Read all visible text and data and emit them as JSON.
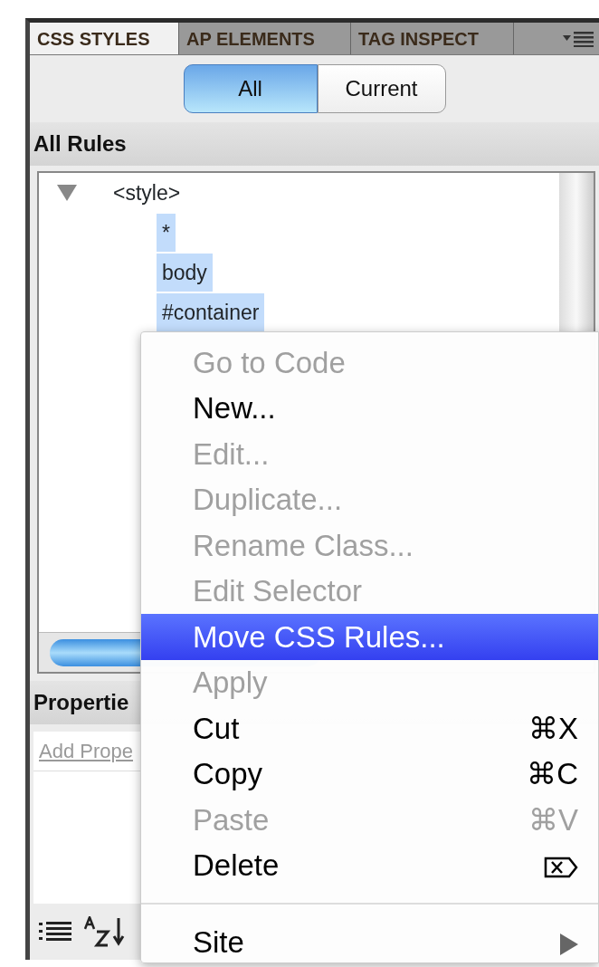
{
  "panel_tabs": [
    {
      "label": "CSS STYLES",
      "selected": true
    },
    {
      "label": "AP ELEMENTS",
      "selected": false
    },
    {
      "label": "TAG INSPECT",
      "selected": false
    }
  ],
  "view_toggle": [
    {
      "label": "All",
      "selected": true
    },
    {
      "label": "Current",
      "selected": false
    }
  ],
  "rules_header": "All Rules",
  "rules_tree": [
    {
      "label": "<style>",
      "expanded": true,
      "selected": false,
      "children": [
        {
          "label": "*",
          "selected": true
        },
        {
          "label": "body",
          "selected": true
        },
        {
          "label": "#container",
          "selected": true
        }
      ]
    }
  ],
  "properties_header": "Propertie",
  "add_property_link": "Add Prope",
  "context_menu": [
    {
      "kind": "command",
      "label": "Go to Code",
      "disabled": true,
      "selected": false
    },
    {
      "kind": "command",
      "label": "New...",
      "disabled": false,
      "selected": false
    },
    {
      "kind": "command",
      "label": "Edit...",
      "disabled": true,
      "selected": false
    },
    {
      "kind": "command",
      "label": "Duplicate...",
      "disabled": true,
      "selected": false
    },
    {
      "kind": "command",
      "label": "Rename Class...",
      "disabled": true,
      "selected": false
    },
    {
      "kind": "command",
      "label": "Edit Selector",
      "disabled": true,
      "selected": false
    },
    {
      "kind": "command",
      "label": "Move CSS Rules...",
      "disabled": false,
      "selected": true
    },
    {
      "kind": "command",
      "label": "Apply",
      "disabled": true,
      "selected": false
    },
    {
      "kind": "command",
      "label": "Cut",
      "shortcut": "⌘X",
      "disabled": false,
      "selected": false
    },
    {
      "kind": "command",
      "label": "Copy",
      "shortcut": "⌘C",
      "disabled": false,
      "selected": false
    },
    {
      "kind": "command",
      "label": "Paste",
      "shortcut": "⌘V",
      "disabled": true,
      "selected": false
    },
    {
      "kind": "delete",
      "label": "Delete",
      "disabled": false,
      "selected": false
    },
    {
      "kind": "separator"
    },
    {
      "kind": "submenu",
      "label": "Site",
      "disabled": false,
      "selected": false
    }
  ]
}
